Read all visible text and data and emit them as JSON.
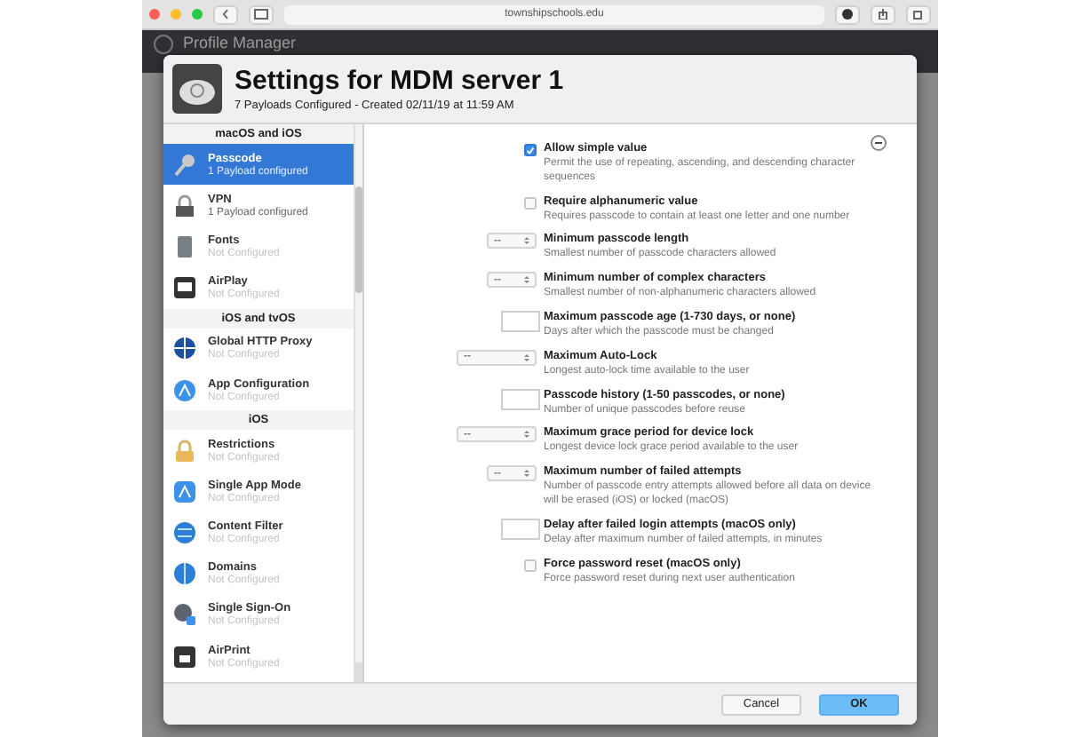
{
  "browser": {
    "address": "townshipschools.edu"
  },
  "app": {
    "title": "Profile Manager"
  },
  "dialog": {
    "title": "Settings for MDM server 1",
    "subtitle": "7 Payloads Configured - Created 02/11/19 at 11:59 AM"
  },
  "sidebar": {
    "sections": [
      {
        "header": "macOS and iOS",
        "items": [
          {
            "name": "Passcode",
            "status": "1 Payload configured",
            "selected": true,
            "configured": true
          },
          {
            "name": "VPN",
            "status": "1 Payload configured",
            "selected": false,
            "configured": true
          },
          {
            "name": "Fonts",
            "status": "Not Configured",
            "selected": false,
            "configured": false
          },
          {
            "name": "AirPlay",
            "status": "Not Configured",
            "selected": false,
            "configured": false
          }
        ]
      },
      {
        "header": "iOS and tvOS",
        "items": [
          {
            "name": "Global HTTP Proxy",
            "status": "Not Configured",
            "selected": false,
            "configured": false
          },
          {
            "name": "App Configuration",
            "status": "Not Configured",
            "selected": false,
            "configured": false
          }
        ]
      },
      {
        "header": "iOS",
        "items": [
          {
            "name": "Restrictions",
            "status": "Not Configured",
            "selected": false,
            "configured": false
          },
          {
            "name": "Single App Mode",
            "status": "Not Configured",
            "selected": false,
            "configured": false
          },
          {
            "name": "Content Filter",
            "status": "Not Configured",
            "selected": false,
            "configured": false
          },
          {
            "name": "Domains",
            "status": "Not Configured",
            "selected": false,
            "configured": false
          },
          {
            "name": "Single Sign-On",
            "status": "Not Configured",
            "selected": false,
            "configured": false
          },
          {
            "name": "AirPrint",
            "status": "Not Configured",
            "selected": false,
            "configured": false
          }
        ]
      }
    ]
  },
  "settings": [
    {
      "kind": "checkbox",
      "checked": true,
      "label": "Allow simple value",
      "description": "Permit the use of repeating, ascending, and descending character sequences"
    },
    {
      "kind": "checkbox",
      "checked": false,
      "label": "Require alphanumeric value",
      "description": "Requires passcode to contain at least one letter and one number"
    },
    {
      "kind": "popup",
      "value": "--",
      "label": "Minimum passcode length",
      "description": "Smallest number of passcode characters allowed"
    },
    {
      "kind": "popup",
      "value": "--",
      "label": "Minimum number of complex characters",
      "description": "Smallest number of non-alphanumeric characters allowed"
    },
    {
      "kind": "field",
      "label": "Maximum passcode age (1-730 days, or none)",
      "description": "Days after which the passcode must be changed"
    },
    {
      "kind": "wide-popup",
      "value": "--",
      "label": "Maximum Auto-Lock",
      "description": "Longest auto-lock time available to the user"
    },
    {
      "kind": "field",
      "label": "Passcode history (1-50 passcodes, or none)",
      "description": "Number of unique passcodes before reuse"
    },
    {
      "kind": "wide-popup",
      "value": "--",
      "label": "Maximum grace period for device lock",
      "description": "Longest device lock grace period available to the user"
    },
    {
      "kind": "popup",
      "value": "--",
      "label": "Maximum number of failed attempts",
      "description": "Number of passcode entry attempts allowed before all data on device will be erased (iOS) or locked (macOS)"
    },
    {
      "kind": "field",
      "label": "Delay after failed login attempts (macOS only)",
      "description": "Delay after maximum number of failed attempts, in minutes"
    },
    {
      "kind": "checkbox",
      "checked": false,
      "label": "Force password reset (macOS only)",
      "description": "Force password reset during next user authentication"
    }
  ],
  "buttons": [
    {
      "label": "Cancel",
      "kind": "secondary"
    },
    {
      "label": "OK",
      "kind": "primary"
    }
  ]
}
